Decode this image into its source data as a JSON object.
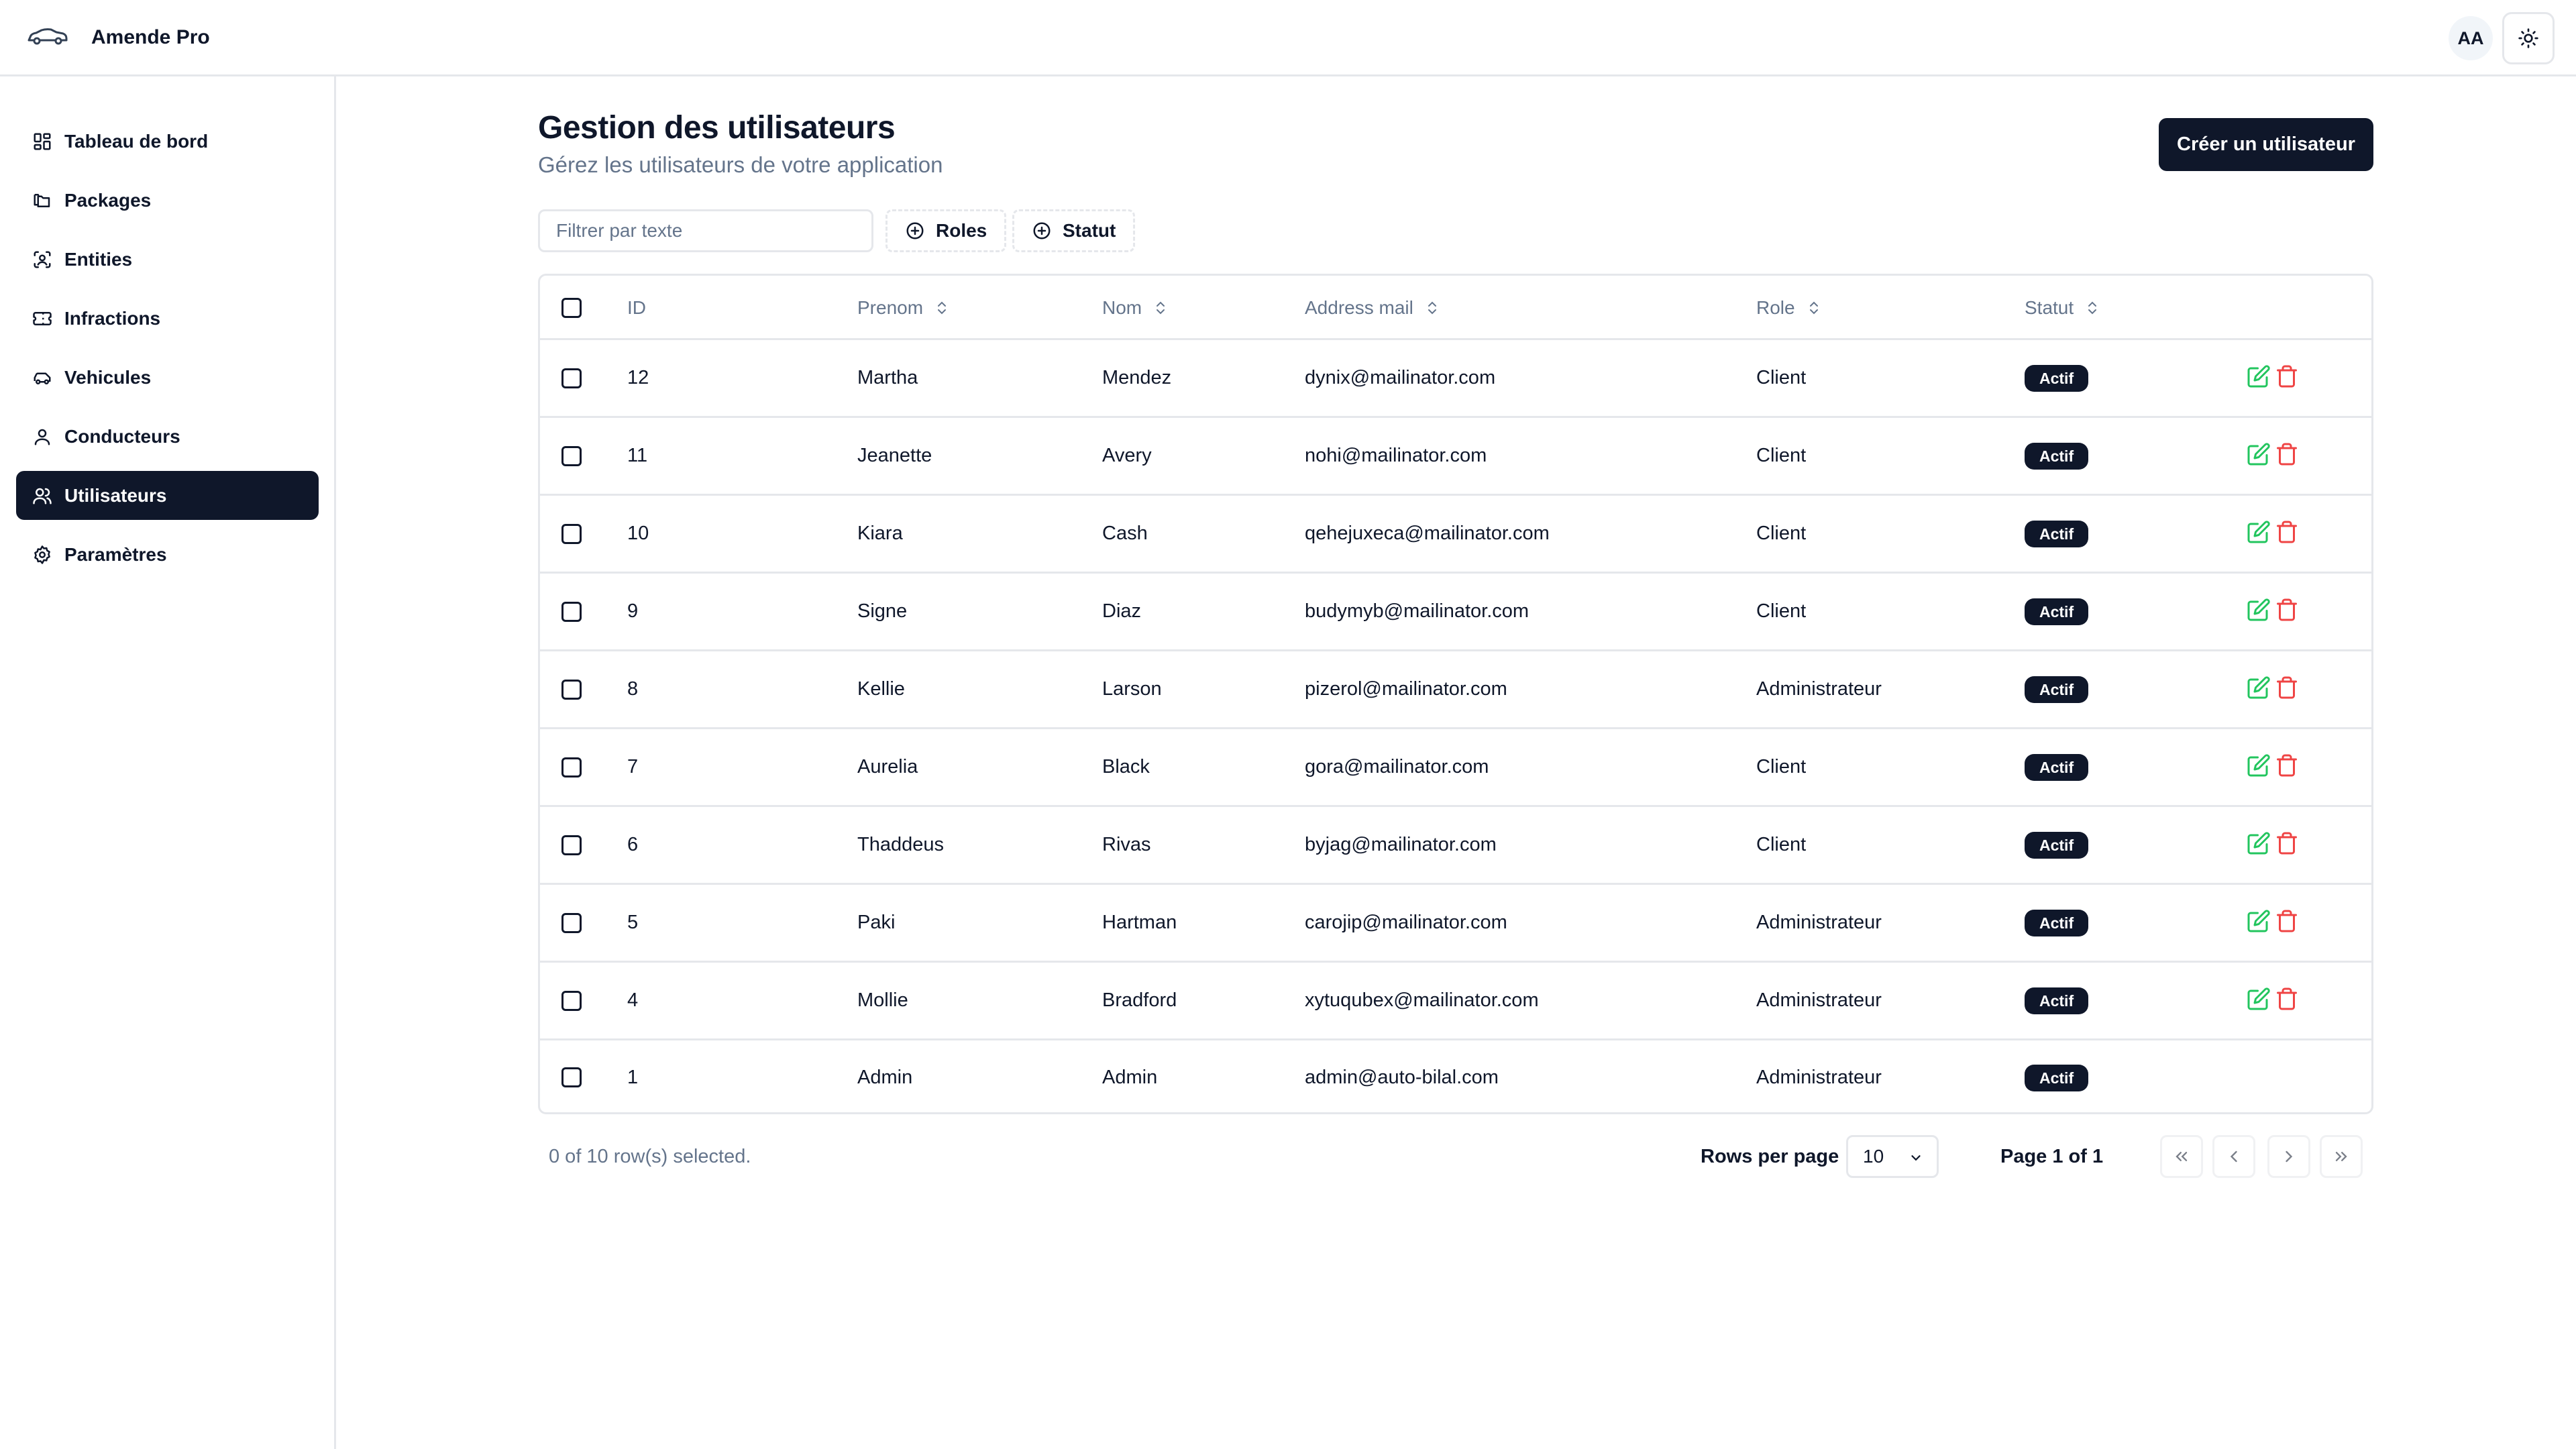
{
  "app": {
    "name": "Amende Pro",
    "avatar_initials": "AA"
  },
  "sidebar": {
    "items": [
      {
        "label": "Tableau de bord",
        "icon": "dashboard-icon",
        "active": false
      },
      {
        "label": "Packages",
        "icon": "folders-icon",
        "active": false
      },
      {
        "label": "Entities",
        "icon": "scan-icon",
        "active": false
      },
      {
        "label": "Infractions",
        "icon": "ticket-icon",
        "active": false
      },
      {
        "label": "Vehicules",
        "icon": "car-icon",
        "active": false
      },
      {
        "label": "Conducteurs",
        "icon": "user-icon",
        "active": false
      },
      {
        "label": "Utilisateurs",
        "icon": "users-icon",
        "active": true
      },
      {
        "label": "Paramètres",
        "icon": "settings-icon",
        "active": false
      }
    ]
  },
  "header": {
    "title": "Gestion des utilisateurs",
    "subtitle": "Gérez les utilisateurs de votre application",
    "create_label": "Créer un utilisateur"
  },
  "filters": {
    "placeholder": "Filtrer par texte",
    "roles_label": "Roles",
    "status_label": "Statut"
  },
  "table": {
    "columns": [
      "ID",
      "Prenom",
      "Nom",
      "Address mail",
      "Role",
      "Statut"
    ],
    "rows": [
      {
        "id": "12",
        "prenom": "Martha",
        "nom": "Mendez",
        "email": "dynix@mailinator.com",
        "role": "Client",
        "statut": "Actif",
        "actions": true
      },
      {
        "id": "11",
        "prenom": "Jeanette",
        "nom": "Avery",
        "email": "nohi@mailinator.com",
        "role": "Client",
        "statut": "Actif",
        "actions": true
      },
      {
        "id": "10",
        "prenom": "Kiara",
        "nom": "Cash",
        "email": "qehejuxeca@mailinator.com",
        "role": "Client",
        "statut": "Actif",
        "actions": true
      },
      {
        "id": "9",
        "prenom": "Signe",
        "nom": "Diaz",
        "email": "budymyb@mailinator.com",
        "role": "Client",
        "statut": "Actif",
        "actions": true
      },
      {
        "id": "8",
        "prenom": "Kellie",
        "nom": "Larson",
        "email": "pizerol@mailinator.com",
        "role": "Administrateur",
        "statut": "Actif",
        "actions": true
      },
      {
        "id": "7",
        "prenom": "Aurelia",
        "nom": "Black",
        "email": "gora@mailinator.com",
        "role": "Client",
        "statut": "Actif",
        "actions": true
      },
      {
        "id": "6",
        "prenom": "Thaddeus",
        "nom": "Rivas",
        "email": "byjag@mailinator.com",
        "role": "Client",
        "statut": "Actif",
        "actions": true
      },
      {
        "id": "5",
        "prenom": "Paki",
        "nom": "Hartman",
        "email": "carojip@mailinator.com",
        "role": "Administrateur",
        "statut": "Actif",
        "actions": true
      },
      {
        "id": "4",
        "prenom": "Mollie",
        "nom": "Bradford",
        "email": "xytuqubex@mailinator.com",
        "role": "Administrateur",
        "statut": "Actif",
        "actions": true
      },
      {
        "id": "1",
        "prenom": "Admin",
        "nom": "Admin",
        "email": "admin@auto-bilal.com",
        "role": "Administrateur",
        "statut": "Actif",
        "actions": false
      }
    ]
  },
  "footer": {
    "selection": "0 of 10 row(s) selected.",
    "rows_per_page_label": "Rows per page",
    "rows_per_page_value": "10",
    "page_info": "Page 1 of 1"
  },
  "colors": {
    "primary": "#0f172a",
    "muted": "#64748b",
    "border": "#e5e7eb",
    "edit": "#22c55e",
    "delete": "#ef4444"
  }
}
